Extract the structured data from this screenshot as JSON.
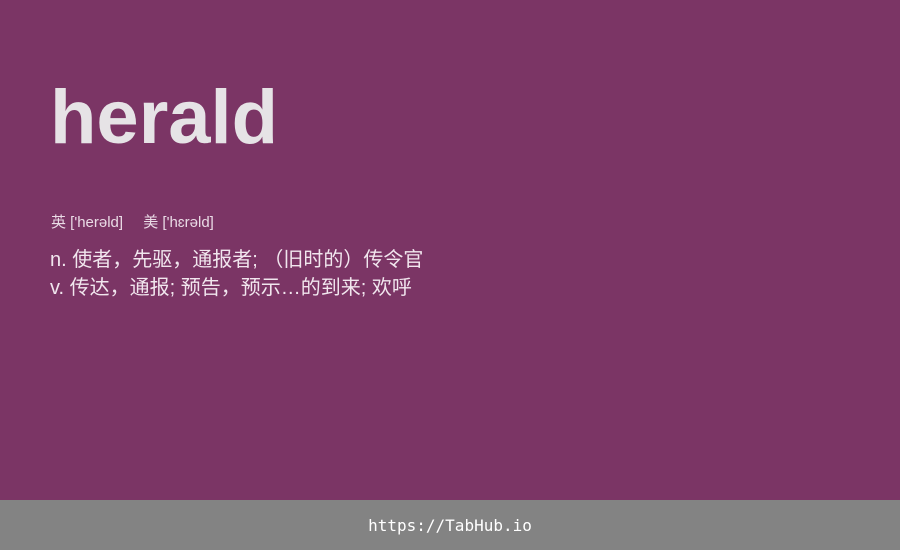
{
  "word": "herald",
  "phonetics": {
    "uk": "英 ['herəld]",
    "us": "美 ['hɛrəld]"
  },
  "definitions": [
    "n. 使者，先驱，通报者; （旧时的）传令官",
    "v. 传达，通报; 预告，预示…的到来; 欢呼"
  ],
  "footer": {
    "url": "https://TabHub.io"
  },
  "colors": {
    "background": "#7b3565",
    "word": "#e6e3e6",
    "footer_bg": "#838383"
  }
}
